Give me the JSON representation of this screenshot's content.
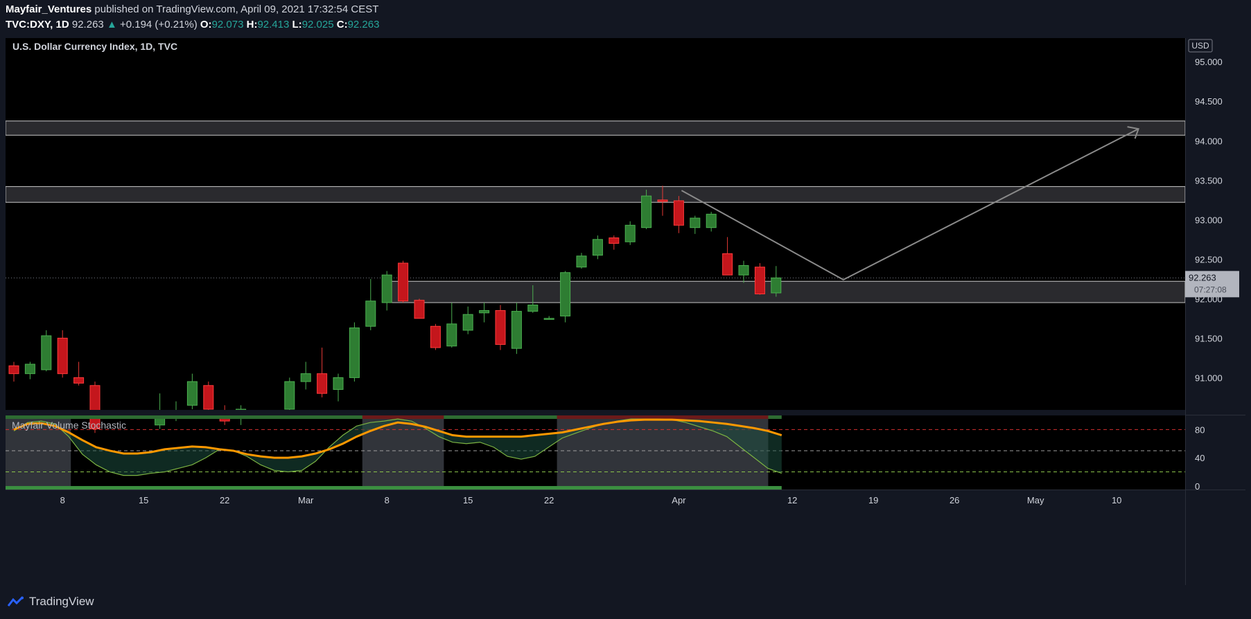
{
  "header": {
    "author": "Mayfair_Ventures",
    "published": "published on TradingView.com, April 09, 2021 17:32:54 CEST",
    "symbol": "TVC:DXY,",
    "interval": "1D",
    "last": "92.263",
    "change_icon": "up-triangle-icon",
    "change": "+0.194 (+0.21%)",
    "o_label": "O:",
    "o_value": "92.073",
    "h_label": "H:",
    "h_value": "92.413",
    "l_label": "L:",
    "l_value": "92.025",
    "c_label": "C:",
    "c_value": "92.263"
  },
  "chart_title": "U.S. Dollar Currency Index, 1D, TVC",
  "currency_badge": "USD",
  "price_label": "92.263",
  "countdown_label": "07:27:08",
  "indicator_title": "Mayfair Volume Stochastic",
  "footer": {
    "brand": "TradingView",
    "brand_icon": "tradingview-logo-icon"
  },
  "colors": {
    "up": "#26a69a",
    "up_body": "#2e7d32",
    "down": "#d0021b",
    "background": "#000000",
    "axis": "#131722"
  },
  "chart_data": [
    {
      "type": "candlestick",
      "title": "U.S. Dollar Currency Index, 1D, TVC",
      "ylim": [
        90.6,
        95.3
      ],
      "yticks": [
        "95.000",
        "94.500",
        "94.000",
        "93.500",
        "93.000",
        "92.500",
        "92.000",
        "91.500",
        "91.000"
      ],
      "xticks": [
        "8",
        "15",
        "22",
        "Mar",
        "8",
        "15",
        "22",
        "Apr",
        "12",
        "19",
        "26",
        "May",
        "10"
      ],
      "candles": [
        {
          "date": "Feb 3",
          "o": 91.15,
          "h": 91.2,
          "l": 90.95,
          "c": 91.05
        },
        {
          "date": "Feb 4",
          "o": 91.05,
          "h": 91.2,
          "l": 90.98,
          "c": 91.17
        },
        {
          "date": "Feb 5",
          "o": 91.1,
          "h": 91.6,
          "l": 91.08,
          "c": 91.53
        },
        {
          "date": "Feb 8",
          "o": 91.5,
          "h": 91.6,
          "l": 91.0,
          "c": 91.05
        },
        {
          "date": "Feb 9",
          "o": 91.0,
          "h": 91.2,
          "l": 90.9,
          "c": 90.93
        },
        {
          "date": "Feb 10",
          "o": 90.9,
          "h": 90.95,
          "l": 90.3,
          "c": 90.35
        },
        {
          "date": "Feb 16",
          "o": 90.4,
          "h": 90.8,
          "l": 90.35,
          "c": 90.5
        },
        {
          "date": "Feb 17",
          "o": 90.5,
          "h": 90.7,
          "l": 90.45,
          "c": 90.58
        },
        {
          "date": "Feb 18",
          "o": 90.65,
          "h": 91.05,
          "l": 90.6,
          "c": 90.95
        },
        {
          "date": "Feb 19",
          "o": 90.9,
          "h": 90.95,
          "l": 90.55,
          "c": 90.6
        },
        {
          "date": "Feb 22",
          "o": 90.58,
          "h": 90.65,
          "l": 90.4,
          "c": 90.45
        },
        {
          "date": "Feb 23",
          "o": 90.5,
          "h": 90.65,
          "l": 90.4,
          "c": 90.6
        },
        {
          "date": "Feb 26",
          "o": 90.6,
          "h": 91.0,
          "l": 90.55,
          "c": 90.95
        },
        {
          "date": "Mar 1",
          "o": 90.95,
          "h": 91.2,
          "l": 90.85,
          "c": 91.05
        },
        {
          "date": "Mar 2",
          "o": 91.05,
          "h": 91.38,
          "l": 90.75,
          "c": 90.8
        },
        {
          "date": "Mar 3",
          "o": 90.85,
          "h": 91.05,
          "l": 90.7,
          "c": 91.0
        },
        {
          "date": "Mar 4",
          "o": 91.0,
          "h": 91.7,
          "l": 90.95,
          "c": 91.63
        },
        {
          "date": "Mar 5",
          "o": 91.65,
          "h": 92.25,
          "l": 91.6,
          "c": 91.97
        },
        {
          "date": "Mar 8",
          "o": 91.95,
          "h": 92.35,
          "l": 91.85,
          "c": 92.3
        },
        {
          "date": "Mar 9",
          "o": 92.45,
          "h": 92.48,
          "l": 91.95,
          "c": 91.97
        },
        {
          "date": "Mar 10",
          "o": 91.98,
          "h": 92.0,
          "l": 91.75,
          "c": 91.75
        },
        {
          "date": "Mar 11",
          "o": 91.65,
          "h": 91.68,
          "l": 91.35,
          "c": 91.38
        },
        {
          "date": "Mar 12",
          "o": 91.4,
          "h": 91.95,
          "l": 91.38,
          "c": 91.68
        },
        {
          "date": "Mar 15",
          "o": 91.6,
          "h": 91.9,
          "l": 91.55,
          "c": 91.8
        },
        {
          "date": "Mar 16",
          "o": 91.82,
          "h": 91.95,
          "l": 91.7,
          "c": 91.85
        },
        {
          "date": "Mar 17",
          "o": 91.85,
          "h": 91.92,
          "l": 91.35,
          "c": 91.42
        },
        {
          "date": "Mar 18",
          "o": 91.37,
          "h": 91.95,
          "l": 91.3,
          "c": 91.84
        },
        {
          "date": "Mar 19",
          "o": 91.84,
          "h": 92.17,
          "l": 91.82,
          "c": 91.92
        },
        {
          "date": "Mar 22",
          "o": 91.75,
          "h": 91.78,
          "l": 91.74,
          "c": 91.75
        },
        {
          "date": "Mar 23",
          "o": 91.78,
          "h": 92.35,
          "l": 91.7,
          "c": 92.33
        },
        {
          "date": "Mar 24",
          "o": 92.4,
          "h": 92.58,
          "l": 92.38,
          "c": 92.54
        },
        {
          "date": "Mar 25",
          "o": 92.55,
          "h": 92.8,
          "l": 92.5,
          "c": 92.75
        },
        {
          "date": "Mar 26",
          "o": 92.77,
          "h": 92.8,
          "l": 92.62,
          "c": 92.7
        },
        {
          "date": "Mar 29",
          "o": 92.72,
          "h": 92.98,
          "l": 92.68,
          "c": 92.93
        },
        {
          "date": "Mar 30",
          "o": 92.9,
          "h": 93.38,
          "l": 92.88,
          "c": 93.3
        },
        {
          "date": "Mar 31",
          "o": 93.25,
          "h": 93.43,
          "l": 93.05,
          "c": 93.23
        },
        {
          "date": "Apr 1",
          "o": 93.24,
          "h": 93.3,
          "l": 92.83,
          "c": 92.93
        },
        {
          "date": "Apr 2",
          "o": 92.9,
          "h": 93.05,
          "l": 92.82,
          "c": 93.02
        },
        {
          "date": "Apr 5",
          "o": 92.9,
          "h": 93.1,
          "l": 92.85,
          "c": 93.07
        },
        {
          "date": "Apr 6",
          "o": 92.57,
          "h": 92.78,
          "l": 92.3,
          "c": 92.3
        },
        {
          "date": "Apr 7",
          "o": 92.3,
          "h": 92.48,
          "l": 92.2,
          "c": 92.42
        },
        {
          "date": "Apr 8",
          "o": 92.4,
          "h": 92.45,
          "l": 92.05,
          "c": 92.06
        },
        {
          "date": "Apr 9",
          "o": 92.073,
          "h": 92.413,
          "l": 92.025,
          "c": 92.263
        }
      ],
      "zones": [
        {
          "from": 94.07,
          "to": 94.25
        },
        {
          "from": 93.22,
          "to": 93.42
        },
        {
          "from": 91.95,
          "to": 92.22
        }
      ],
      "projection_path": [
        93.37,
        92.24,
        94.15
      ],
      "last_price": 92.263
    },
    {
      "type": "line",
      "title": "Mayfair Volume Stochastic",
      "ylim": [
        -5,
        100
      ],
      "yticks": [
        "80",
        "40",
        "0"
      ],
      "levels": [
        80,
        50,
        20
      ],
      "series": [
        {
          "values": [
            78,
            90,
            92,
            88,
            70,
            45,
            30,
            20,
            15,
            15,
            18,
            20,
            25,
            30,
            40,
            52,
            50,
            42,
            30,
            22,
            20,
            22,
            35,
            55,
            72,
            85,
            90,
            92,
            95,
            92,
            82,
            70,
            62,
            60,
            62,
            55,
            42,
            38,
            42,
            55,
            68,
            75,
            82,
            88,
            92,
            95,
            95,
            95,
            94,
            90,
            84,
            78,
            70,
            55,
            40,
            25,
            18
          ]
        },
        {
          "values": [
            80,
            88,
            89,
            85,
            76,
            65,
            55,
            50,
            46,
            46,
            48,
            52,
            54,
            56,
            55,
            52,
            50,
            45,
            42,
            40,
            40,
            42,
            46,
            52,
            60,
            70,
            78,
            85,
            90,
            88,
            84,
            78,
            72,
            70,
            70,
            70,
            70,
            70,
            72,
            74,
            76,
            80,
            84,
            88,
            91,
            93,
            94,
            94,
            94,
            93,
            92,
            90,
            88,
            85,
            82,
            78,
            72
          ]
        }
      ],
      "highlight_ranges": [
        "Feb 3 - Feb 8",
        "Mar 5 - Mar 11",
        "Mar 23 - Apr 8"
      ]
    }
  ]
}
